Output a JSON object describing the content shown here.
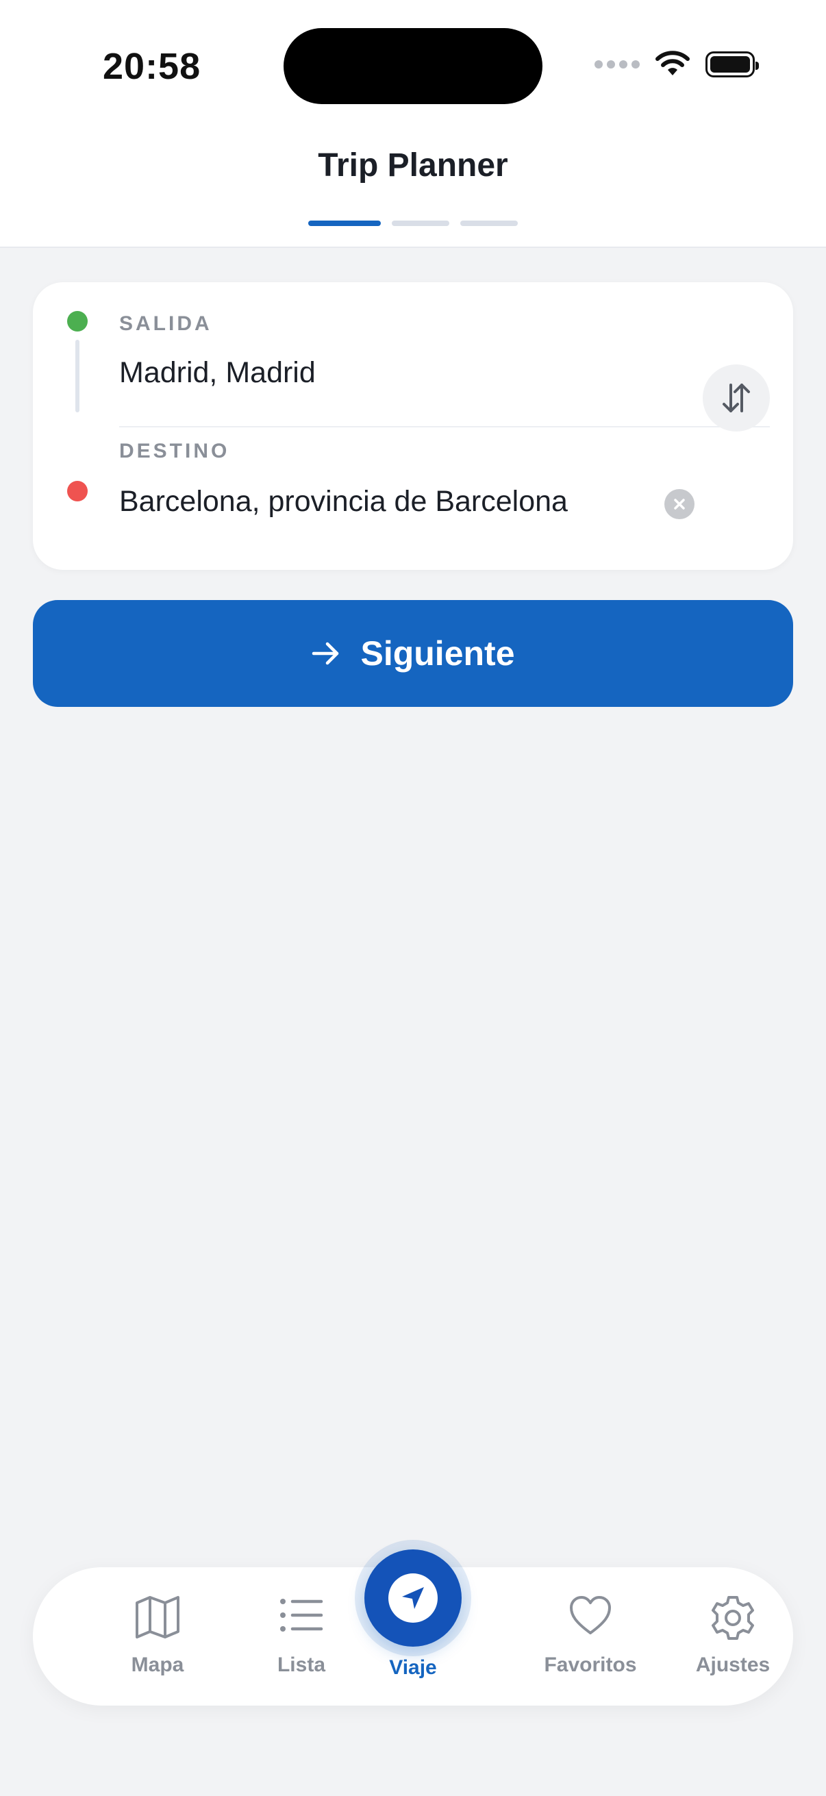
{
  "status_bar": {
    "time": "20:58"
  },
  "header": {
    "title": "Trip Planner",
    "steps_total": 3,
    "current_step": 1
  },
  "route": {
    "origin_label": "SALIDA",
    "origin_value": "Madrid, Madrid",
    "destination_label": "DESTINO",
    "destination_value": "Barcelona, provincia de Barcelona"
  },
  "next_button": {
    "label": "Siguiente"
  },
  "tabbar": {
    "items": [
      {
        "label": "Mapa",
        "icon": "map-icon"
      },
      {
        "label": "Lista",
        "icon": "list-icon"
      },
      {
        "label": "Viaje",
        "icon": "navigation-arrow-icon",
        "active": true
      },
      {
        "label": "Favoritos",
        "icon": "heart-icon"
      },
      {
        "label": "Ajustes",
        "icon": "gear-icon"
      }
    ]
  },
  "colors": {
    "accent": "#1565c0",
    "origin_dot": "#4caf50",
    "destination_dot": "#ef5350",
    "background": "#f2f3f5"
  }
}
